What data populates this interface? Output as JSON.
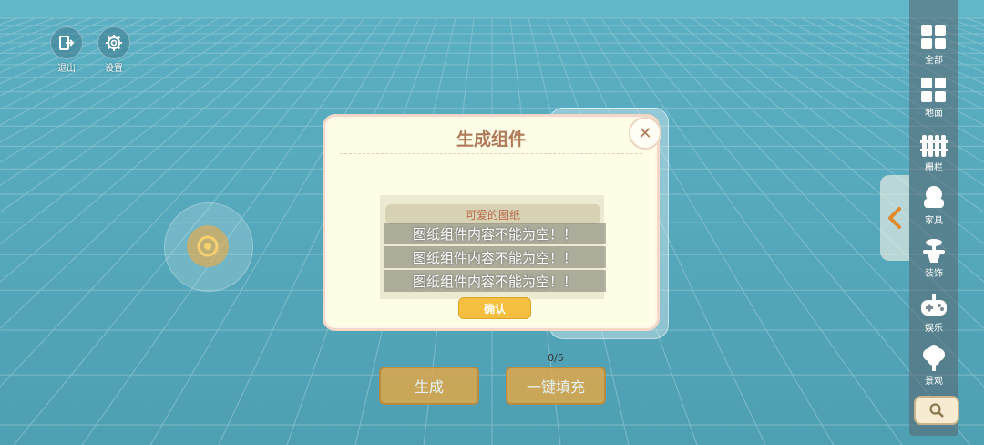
{
  "top_buttons": [
    {
      "label": "退出",
      "icon": "exit-icon"
    },
    {
      "label": "设置",
      "icon": "gear-icon"
    }
  ],
  "sidebar": {
    "items": [
      {
        "label": "全部",
        "icon": "grid-all-icon"
      },
      {
        "label": "地面",
        "icon": "ground-icon"
      },
      {
        "label": "栅栏",
        "icon": "fence-icon"
      },
      {
        "label": "家具",
        "icon": "furniture-icon"
      },
      {
        "label": "装饰",
        "icon": "decoration-icon"
      },
      {
        "label": "娱乐",
        "icon": "gamepad-icon"
      },
      {
        "label": "景观",
        "icon": "tree-icon"
      }
    ],
    "search_icon": "search-icon"
  },
  "dialog": {
    "title": "生成组件",
    "close_label": "✕",
    "blueprint_name": "可爱的图纸",
    "toasts": [
      "图纸组件内容不能为空！！",
      "图纸组件内容不能为空！！",
      "图纸组件内容不能为空！！"
    ],
    "confirm_label": "确认"
  },
  "bottom": {
    "counter": "0/5",
    "generate_label": "生成",
    "fill_label": "一键填充"
  },
  "colors": {
    "floor": "#5aa9bd",
    "accent": "#e0a84a",
    "dialog_bg": "#fefde6",
    "title_color": "#b07a5a"
  }
}
